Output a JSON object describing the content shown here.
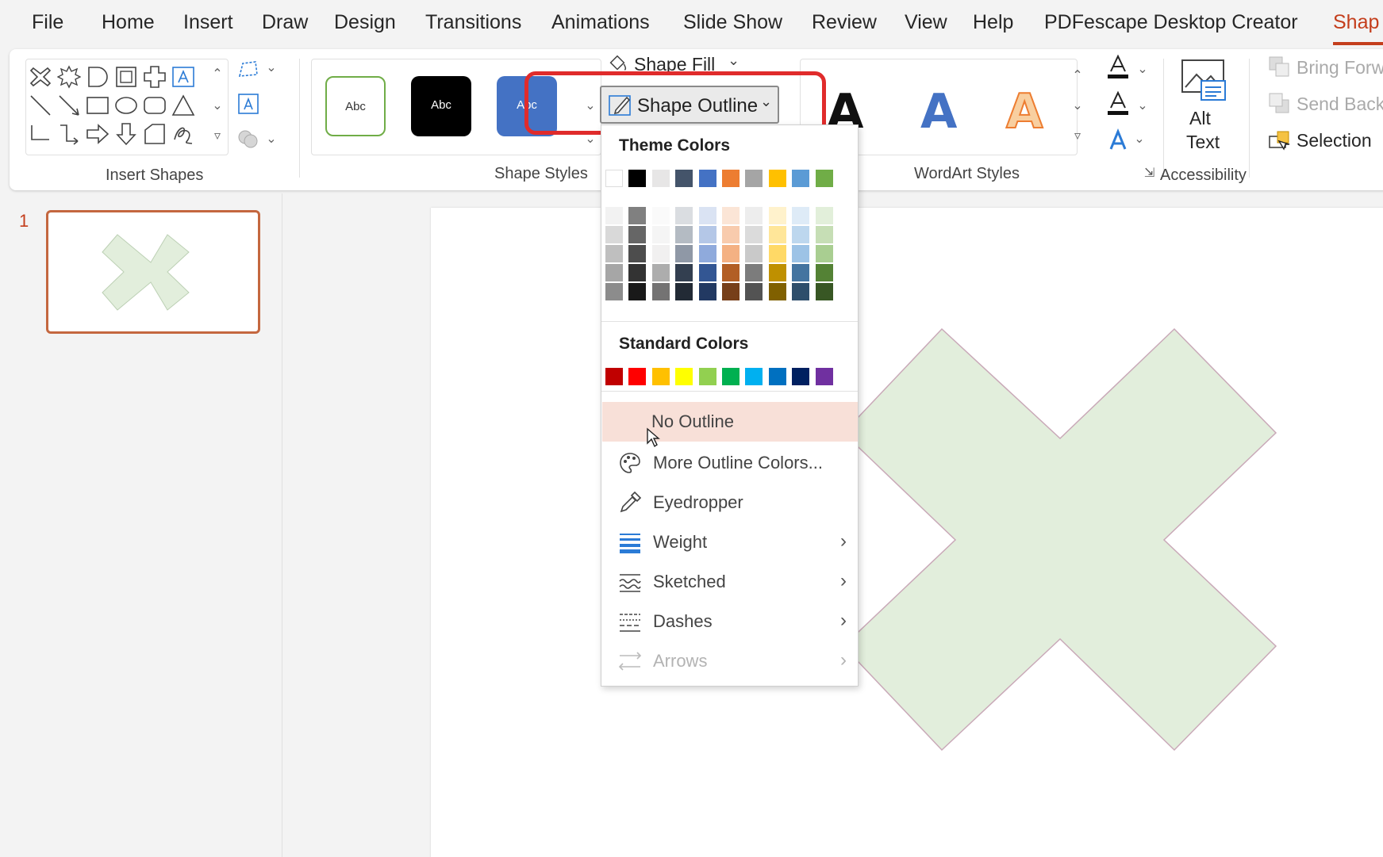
{
  "menu": {
    "tabs": [
      "File",
      "Home",
      "Insert",
      "Draw",
      "Design",
      "Transitions",
      "Animations",
      "Slide Show",
      "Review",
      "View",
      "Help",
      "PDFescape Desktop Creator",
      "Shap"
    ],
    "active_tab": "Shap"
  },
  "ribbon": {
    "insert_shapes": {
      "label": "Insert Shapes"
    },
    "shape_styles": {
      "label": "Shape Styles",
      "styles": [
        "Abc",
        "Abc",
        "Abc"
      ],
      "shape_fill_label": "Shape Fill",
      "shape_outline_label": "Shape Outline"
    },
    "wordart_styles": {
      "label": "WordArt Styles",
      "letters": [
        "A",
        "A",
        "A"
      ]
    },
    "accessibility": {
      "label": "Accessibility",
      "alt_text_line1": "Alt",
      "alt_text_line2": "Text"
    },
    "arrange": {
      "bring_forward": "Bring Forw",
      "send_backward": "Send Back",
      "selection_pane": "Selection"
    }
  },
  "slides_panel": {
    "slide_number": "1"
  },
  "dropdown": {
    "theme_colors_heading": "Theme Colors",
    "standard_colors_heading": "Standard Colors",
    "theme_colors": [
      "#ffffff",
      "#000000",
      "#e7e6e6",
      "#44546a",
      "#4472c4",
      "#ed7d31",
      "#a5a5a5",
      "#ffc000",
      "#5b9bd5",
      "#70ad47"
    ],
    "standard_colors": [
      "#c00000",
      "#ff0000",
      "#ffc000",
      "#ffff00",
      "#92d050",
      "#00b050",
      "#00b0f0",
      "#0070c0",
      "#002060",
      "#7030a0"
    ],
    "items": {
      "no_outline": "No Outline",
      "more_colors": "More Outline Colors...",
      "eyedropper": "Eyedropper",
      "weight": "Weight",
      "sketched": "Sketched",
      "dashes": "Dashes",
      "arrows": "Arrows"
    }
  },
  "colors": {
    "accent": "#c43e1c",
    "highlight": "#e02b2b",
    "shape_fill": "#e2eedc",
    "hover": "#f8e0d8"
  }
}
